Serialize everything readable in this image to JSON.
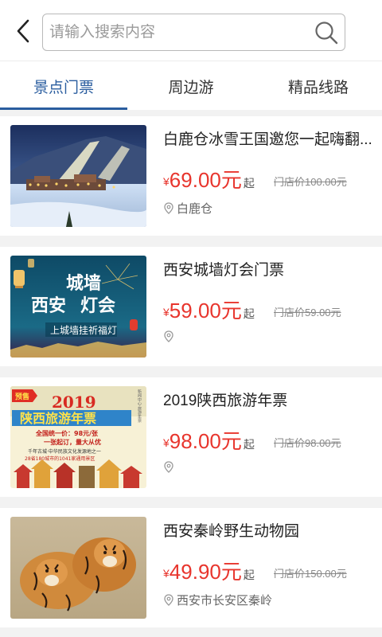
{
  "search": {
    "placeholder": "请输入搜索内容"
  },
  "tabs": [
    {
      "label": "景点门票",
      "active": true
    },
    {
      "label": "周边游",
      "active": false
    },
    {
      "label": "精品线路",
      "active": false
    }
  ],
  "items": [
    {
      "title": "白鹿仓冰雪王国邀您一起嗨翻...",
      "yen": "¥",
      "price": "69.00元",
      "suffix": "起",
      "original": "门店价100.00元",
      "location": "白鹿仓",
      "image": "snow-resort-night-photo"
    },
    {
      "title": "西安城墙灯会门票",
      "yen": "¥",
      "price": "59.00元",
      "suffix": "起",
      "original": "门店价59.00元",
      "location": "",
      "image": "city-wall-lantern-poster",
      "image_text": {
        "line1": "城墙",
        "line2": "西安",
        "line3": "灯会",
        "banner": "上城墙挂祈福灯"
      }
    },
    {
      "title": "2019陕西旅游年票",
      "yen": "¥",
      "price": "98.00元",
      "suffix": "起",
      "original": "门店价98.00元",
      "location": "",
      "image": "shaanxi-travel-pass-poster",
      "image_text": {
        "tag": "预售",
        "year": "2019",
        "name": "陕西旅游年票",
        "l1": "全国统一价：98元/张",
        "l2": "一张起订，量大从优",
        "l3": "千年古城·中华民族文化发源地之一",
        "l4": "28省180城市的1041家通用景区",
        "side": "新闻中心·旅游年票"
      }
    },
    {
      "title": "西安秦岭野生动物园",
      "yen": "¥",
      "price": "49.90元",
      "suffix": "起",
      "original": "门店价150.00元",
      "location": "西安市长安区秦岭",
      "image": "tigers-photo"
    }
  ]
}
